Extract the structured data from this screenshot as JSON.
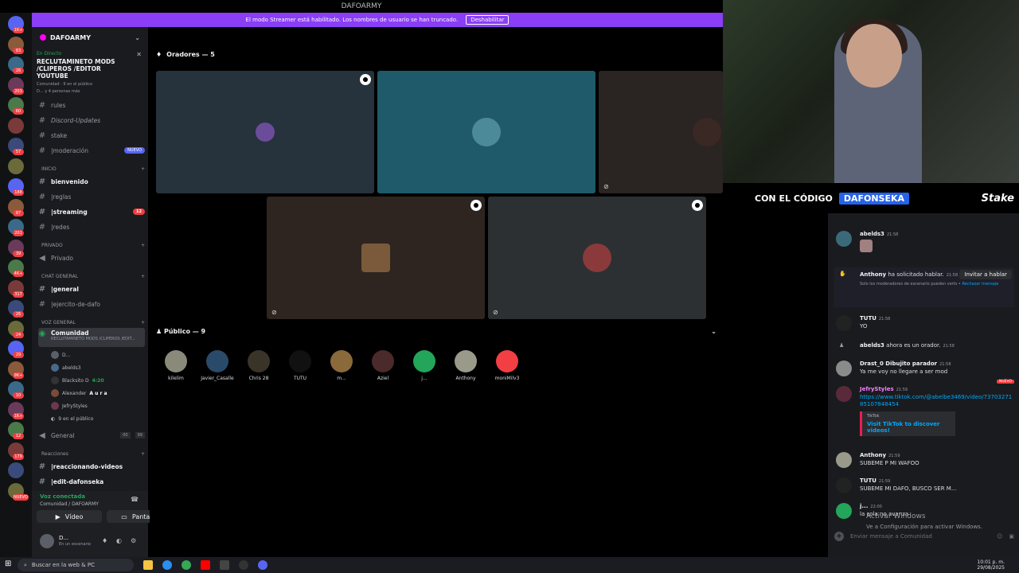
{
  "window": {
    "title": "DAFOARMY"
  },
  "streamer_banner": {
    "text": "El modo Streamer está habilitado. Los nombres de usuario se han truncado.",
    "button": "Deshabilitar"
  },
  "server_rail": {
    "badges": [
      "1K+",
      "83",
      "26",
      "203",
      "60",
      "",
      "57",
      "",
      "188",
      "87",
      "201",
      "39",
      "4K+",
      "317",
      "26",
      "24",
      "29",
      "9K+",
      "10",
      "1K+",
      "12",
      "179",
      "",
      "NUEVO"
    ]
  },
  "sidebar": {
    "guild_name": "DAFOARMY",
    "event": {
      "status": "En Directo",
      "title": "RECLUTAMINETO MODS /CLIPEROS /EDITOR YOUTUBE",
      "meta1": "Comunidad",
      "meta2": "9 en el público",
      "meta3": "D... y 4 personas más"
    },
    "channels_top": [
      {
        "name": "rules",
        "icon": "#"
      },
      {
        "name": "Discord-Updates",
        "icon": "#"
      },
      {
        "name": "stake",
        "icon": "#"
      },
      {
        "name": "|moderación",
        "icon": "#",
        "pill": "NUEVO"
      }
    ],
    "cat_inicio": "INICIO",
    "channels_inicio": [
      {
        "name": "bienvenido",
        "bold": true
      },
      {
        "name": "|reglas"
      },
      {
        "name": "|streaming",
        "bold": true,
        "badge": "12"
      },
      {
        "name": "|redes"
      }
    ],
    "cat_privado": "PRIVADO",
    "privado": "Privado",
    "cat_chat": "CHAT GENERAL",
    "chat_channels": [
      {
        "name": "|general",
        "bold": true
      },
      {
        "name": "|ejercito-de-dafo"
      }
    ],
    "cat_voz": "VOZ GENERAL",
    "voice_channel": {
      "name": "Comunidad",
      "sub": "RECLUTAMINETO MODS /CLIPEROS /EDIT..."
    },
    "voice_users": [
      "D...",
      "abelds3",
      "Blacksito D",
      "Alexander",
      "JefryStyles"
    ],
    "blacksito_tag": "4:20",
    "alexander_tag": "A u r a",
    "voice_public": "9 en el público",
    "general_voice": {
      "name": "General",
      "c1": "00",
      "c2": "99"
    },
    "cat_reacciones": "Reacciones",
    "reacciones": [
      {
        "name": "|reaccionando-videos",
        "bold": true
      },
      {
        "name": "|edit-dafonseka",
        "bold": true
      }
    ]
  },
  "voice_panel": {
    "status": "Voz conectada",
    "location": "Comunidad / DAFOARMY",
    "video": "Vídeo",
    "screen": "Pantalla",
    "user": "D...",
    "user_status": "En un escenario"
  },
  "stage": {
    "speakers_label": "Oradores — 5",
    "public_label": "Público — 9",
    "audience": [
      "kilelim",
      "Javier_Casalle",
      "Chris 28",
      "TUTU",
      "m...",
      "Aziel",
      "j...",
      "Anthony",
      "moniMilv3"
    ]
  },
  "promo": {
    "text": "CON EL CÓDIGO",
    "code": "DAFONSEKA",
    "brand": "Stake"
  },
  "chat": {
    "messages": [
      {
        "name": "abelds3",
        "time": "21:58",
        "text": ""
      },
      {
        "name": "Anthony",
        "time": "21:58",
        "text": "ha solicitado hablar.",
        "action": "Invitar a hablar",
        "note": "Solo los moderadores de escenario pueden verlo •",
        "note_link": "Rechazar mensaje"
      },
      {
        "name": "TUTU",
        "time": "21:58",
        "text": "YO"
      },
      {
        "name": "abelds3",
        "time": "21:58",
        "text": "ahora es un orador."
      },
      {
        "name": "Drast_0 Dibujito parador",
        "time": "21:58",
        "text": "Ya me voy no llegare a ser mod"
      },
      {
        "name": "JefryStyles",
        "time": "21:59",
        "text": "https://www.tiktok.com/@abelbe3469/video/7370327185107848454",
        "embed_source": "TikTok",
        "embed_title": "Visit TikTok to discover videos!",
        "new": "NUEVO"
      },
      {
        "name": "Anthony",
        "time": "21:59",
        "text": "SUBEME P MI WAFOO"
      },
      {
        "name": "TUTU",
        "time": "21:59",
        "text": "SUBEME MI DAFO, BUSCO SER M..."
      },
      {
        "name": "j...",
        "time": "22:00",
        "text": "la cola no avanza"
      }
    ],
    "input_placeholder": "Enviar mensaje a Comunidad"
  },
  "watermark": {
    "title": "Activar Windows",
    "body": "Ve a Configuración para activar Windows."
  },
  "taskbar": {
    "search": "Buscar en la web & PC",
    "time": "10:01 p. m.",
    "date": "29/08/2025"
  },
  "colors": {
    "accent": "#8a3ef5",
    "green": "#23a55a",
    "red": "#f23f43",
    "blue": "#2563eb"
  }
}
